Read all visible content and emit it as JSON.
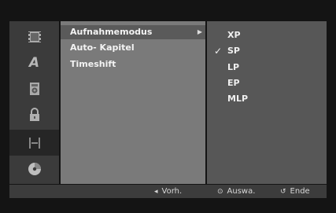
{
  "rail": {
    "items": [
      {
        "name": "film-icon",
        "active": false
      },
      {
        "name": "language-icon",
        "glyph": "A",
        "active": false
      },
      {
        "name": "audio-speaker-icon",
        "active": false
      },
      {
        "name": "lock-icon",
        "active": false
      },
      {
        "name": "record-settings-icon",
        "active": true
      },
      {
        "name": "disc-icon",
        "active": false
      }
    ]
  },
  "settings": {
    "items": [
      {
        "label": "Aufnahmemodus",
        "selected": true
      },
      {
        "label": "Auto- Kapitel",
        "selected": false
      },
      {
        "label": "Timeshift",
        "selected": false
      }
    ],
    "arrow": "▶"
  },
  "options": {
    "items": [
      {
        "label": "XP",
        "checked": false
      },
      {
        "label": "SP",
        "checked": true
      },
      {
        "label": "LP",
        "checked": false
      },
      {
        "label": "EP",
        "checked": false
      },
      {
        "label": "MLP",
        "checked": false
      }
    ],
    "check_glyph": "✓"
  },
  "footer": {
    "back": {
      "icon": "◂",
      "label": "Vorh."
    },
    "select": {
      "icon": "⊙",
      "label": "Auswa."
    },
    "end": {
      "icon": "↺",
      "label": "Ende"
    }
  },
  "colors": {
    "background": "#141414",
    "rail": "#3b3b3b",
    "settings_panel": "#7a7a7a",
    "options_panel": "#575757",
    "highlight": "#5a5a5a",
    "footer": "#3c3c3c"
  }
}
